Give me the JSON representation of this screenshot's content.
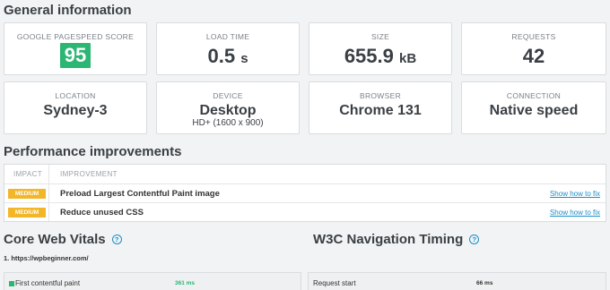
{
  "general": {
    "title": "General information",
    "cards": [
      {
        "label": "GOOGLE PAGESPEED SCORE",
        "value": "95"
      },
      {
        "label": "LOAD TIME",
        "value": "0.5",
        "unit": "s"
      },
      {
        "label": "SIZE",
        "value": "655.9",
        "unit": "kB"
      },
      {
        "label": "REQUESTS",
        "value": "42"
      },
      {
        "label": "LOCATION",
        "value": "Sydney-3"
      },
      {
        "label": "DEVICE",
        "value": "Desktop",
        "sub": "HD+ (1600 x 900)"
      },
      {
        "label": "BROWSER",
        "value": "Chrome 131"
      },
      {
        "label": "CONNECTION",
        "value": "Native speed"
      }
    ],
    "score_color": "#2bb673"
  },
  "performance": {
    "title": "Performance improvements",
    "col_impact": "IMPACT",
    "col_improvement": "IMPROVEMENT",
    "rows": [
      {
        "impact": "MEDIUM",
        "text": "Preload Largest Contentful Paint image",
        "link": "Show how to fix"
      },
      {
        "impact": "MEDIUM",
        "text": "Reduce unused CSS",
        "link": "Show how to fix"
      }
    ],
    "badge_color": "#f3b629",
    "link_color": "#1a8fc9"
  },
  "cwv": {
    "title": "Core Web Vitals",
    "help_icon": "question-circle-icon",
    "url": "1. https://wpbeginner.com/",
    "metric_name": "First contentful paint",
    "metric_value": "361 ms"
  },
  "w3c": {
    "title": "W3C Navigation Timing",
    "help_icon": "question-circle-icon",
    "metric_name": "Request start",
    "metric_value": "66 ms"
  }
}
